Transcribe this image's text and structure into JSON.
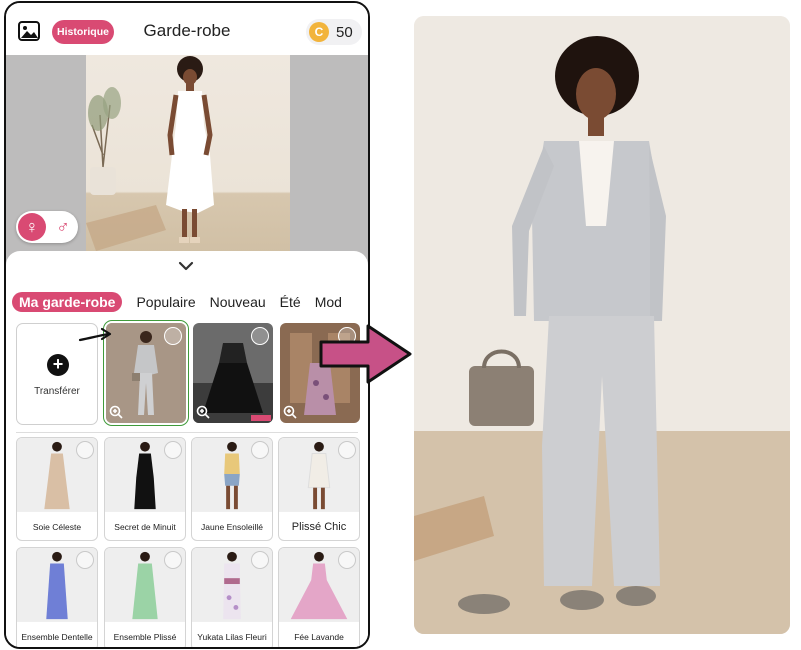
{
  "app": {
    "title": "Garde-robe",
    "history_label": "Historique",
    "coin_symbol": "C",
    "coin_count": "50",
    "accent": "#d94a73"
  },
  "gender": {
    "female_symbol": "♀",
    "male_symbol": "♂",
    "selected": "female"
  },
  "tabs": [
    {
      "label": "Ma garde-robe",
      "active": true
    },
    {
      "label": "Populaire"
    },
    {
      "label": "Nouveau"
    },
    {
      "label": "Été"
    },
    {
      "label": "Mod"
    }
  ],
  "wardrobe": {
    "upload_label": "Transférer",
    "items": [
      {
        "icon": "grey-suit-photo",
        "selected": true
      },
      {
        "icon": "black-tulle-skirt-photo"
      },
      {
        "icon": "floral-skirt-photo"
      }
    ]
  },
  "catalog": [
    {
      "name": "Soie Céleste",
      "color": "#d9bfa5"
    },
    {
      "name": "Secret de Minuit",
      "color": "#111111"
    },
    {
      "name": "Jaune Ensoleillé",
      "color": "#e8c87a"
    },
    {
      "name": "Plissé Chic",
      "color": "#f1ede6"
    },
    {
      "name": "Ensemble Dentelle",
      "color": "#6f7fd6"
    },
    {
      "name": "Ensemble Plissé",
      "color": "#9bd3a6"
    },
    {
      "name": "Yukata Lilas Fleuri",
      "color": "#d9c7e5"
    },
    {
      "name": "Fée Lavande",
      "color": "#e4a6c8"
    }
  ]
}
